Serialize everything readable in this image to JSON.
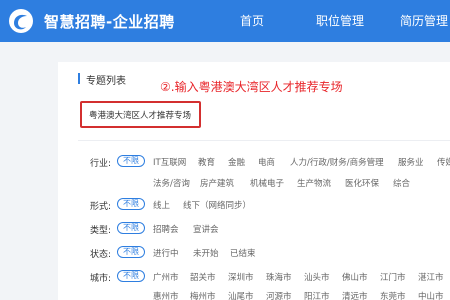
{
  "header": {
    "brand": "智慧招聘-企业招聘",
    "nav": [
      "首页",
      "职位管理",
      "简历管理"
    ],
    "bg_color": "#2e7ee0",
    "logo_icon": "logo-icon"
  },
  "panel": {
    "title": "专题列表",
    "annotation": "②.输入粤港澳大湾区人才推荐专场",
    "search_value": "粤港澳大湾区人才推荐专场",
    "highlight_color": "#d32f2f"
  },
  "filters": [
    {
      "label": "行业:",
      "selected": "不限",
      "options_line1": [
        "IT互联网",
        "教育",
        "金融",
        "电商",
        "人力/行政/财务/商务管理",
        "服务业",
        "传媒"
      ],
      "options_line2": [
        "法务/咨询",
        "房产建筑",
        "机械电子",
        "生产物流",
        "医化环保",
        "综合"
      ]
    },
    {
      "label": "形式:",
      "selected": "不限",
      "options": [
        "线上",
        "线下（网络同步）"
      ]
    },
    {
      "label": "类型:",
      "selected": "不限",
      "options": [
        "招聘会",
        "宣讲会"
      ]
    },
    {
      "label": "状态:",
      "selected": "不限",
      "options": [
        "进行中",
        "未开始",
        "已结束"
      ]
    },
    {
      "label": "城市:",
      "selected": "不限",
      "options_line1": [
        "广州市",
        "韶关市",
        "深圳市",
        "珠海市",
        "汕头市",
        "佛山市",
        "江门市",
        "湛江市"
      ],
      "options_line2": [
        "惠州市",
        "梅州市",
        "汕尾市",
        "河源市",
        "阳江市",
        "清远市",
        "东莞市",
        "中山市"
      ]
    }
  ]
}
